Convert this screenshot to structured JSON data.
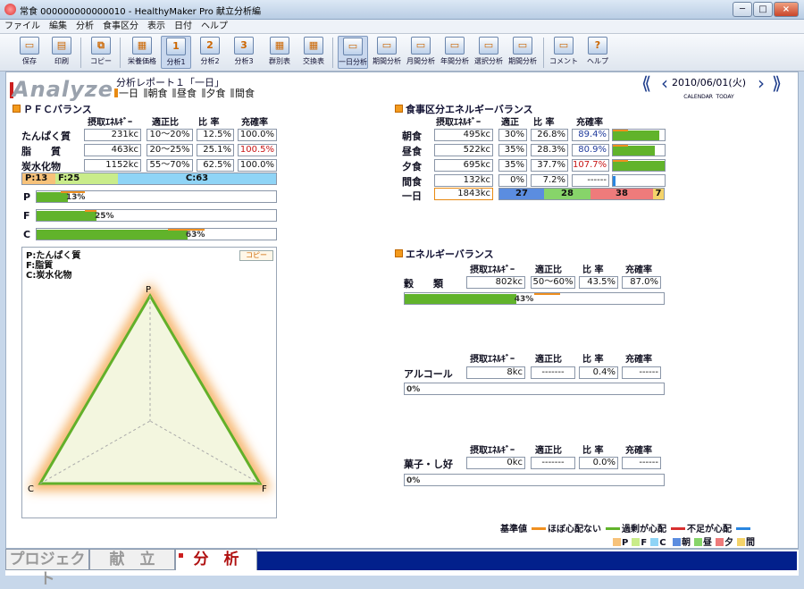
{
  "window": {
    "title": "常食 000000000000010 - HealthyMaker Pro 献立分析編",
    "min": "─",
    "max": "□",
    "close": "×"
  },
  "menu": [
    "ファイル",
    "編集",
    "分析",
    "食事区分",
    "表示",
    "日付",
    "ヘルプ"
  ],
  "toolbar": [
    {
      "label": "保存",
      "glyph": "▭"
    },
    {
      "label": "印刷",
      "glyph": "▤"
    },
    {
      "label": "コピー",
      "glyph": "⧉"
    },
    {
      "label": "栄養価格",
      "glyph": "▦"
    },
    {
      "label": "分析1",
      "glyph": "1"
    },
    {
      "label": "分析2",
      "glyph": "2"
    },
    {
      "label": "分析3",
      "glyph": "3"
    },
    {
      "label": "群別表",
      "glyph": "▦"
    },
    {
      "label": "交換表",
      "glyph": "▦"
    },
    {
      "label": "一日分析",
      "glyph": "▭"
    },
    {
      "label": "期間分析",
      "glyph": "▭"
    },
    {
      "label": "月間分析",
      "glyph": "▭"
    },
    {
      "label": "年間分析",
      "glyph": "▭"
    },
    {
      "label": "選択分析",
      "glyph": "▭"
    },
    {
      "label": "期間分析",
      "glyph": "▭"
    },
    {
      "label": "コメント",
      "glyph": "▭"
    },
    {
      "label": "ヘルプ",
      "glyph": "?"
    }
  ],
  "logo": "Analyze",
  "report": {
    "title": "分析レポート１「一日」",
    "tabs": [
      "一日",
      "朝食",
      "昼食",
      "夕食",
      "間食"
    ]
  },
  "date": {
    "value": "2010/06/01(火)",
    "calendar": "CALENDAR",
    "today": "TODAY"
  },
  "pfc": {
    "title": "ＰＦＣバランス",
    "headers": [
      "摂取ｴﾈﾙｷﾞｰ",
      "適正比",
      "比 率",
      "充確率"
    ],
    "rows": [
      {
        "label": "たんぱく質",
        "intake": "231kc",
        "range": "10～20%",
        "ratio": "12.5%",
        "rate": "100.0%"
      },
      {
        "label": "脂　　質",
        "intake": "463kc",
        "range": "20～25%",
        "ratio": "25.1%",
        "rate": "100.5%"
      },
      {
        "label": "炭水化物",
        "intake": "1152kc",
        "range": "55～70%",
        "ratio": "62.5%",
        "rate": "100.0%"
      }
    ],
    "stack": [
      {
        "label": "P:13",
        "value": 13
      },
      {
        "label": "F:25",
        "value": 25
      },
      {
        "label": "C:63",
        "value": 63
      }
    ],
    "bars": [
      {
        "letter": "P",
        "value": 13,
        "label": "13%"
      },
      {
        "letter": "F",
        "value": 25,
        "label": "25%"
      },
      {
        "letter": "C",
        "value": 63,
        "label": "63%"
      }
    ],
    "legend": [
      "P:たんぱく質",
      "F:脂質",
      "C:炭水化物"
    ],
    "copy": "コピー",
    "radar": {
      "p": "P",
      "c": "C",
      "f": "F"
    }
  },
  "meal": {
    "title": "食事区分エネルギーバランス",
    "headers": [
      "摂取ｴﾈﾙｷﾞｰ",
      "適正",
      "比 率",
      "充確率"
    ],
    "rows": [
      {
        "label": "朝食",
        "intake": "495kc",
        "std": "30%",
        "ratio": "26.8%",
        "rate": "89.4%",
        "fill": 89.4
      },
      {
        "label": "昼食",
        "intake": "522kc",
        "std": "35%",
        "ratio": "28.3%",
        "rate": "80.9%",
        "fill": 80.9
      },
      {
        "label": "夕食",
        "intake": "695kc",
        "std": "35%",
        "ratio": "37.7%",
        "rate": "107.7%",
        "fill": 100
      },
      {
        "label": "間食",
        "intake": "132kc",
        "std": "0%",
        "ratio": "7.2%",
        "rate": "------",
        "fill": 5
      }
    ],
    "total": {
      "label": "一日",
      "intake": "1843kc",
      "split": [
        {
          "label": "27",
          "value": 27
        },
        {
          "label": "28",
          "value": 28
        },
        {
          "label": "38",
          "value": 38
        },
        {
          "label": "7",
          "value": 7
        }
      ]
    }
  },
  "energy": {
    "title": "エネルギーバランス",
    "headers": [
      "摂取ｴﾈﾙｷﾞｰ",
      "適正比",
      "比 率",
      "充確率"
    ],
    "blocks": [
      {
        "label": "穀　　類",
        "intake": "802kc",
        "range": "50～60%",
        "ratio": "43.5%",
        "rate": "87.0%",
        "bar": 43,
        "bar_label": "43%"
      },
      {
        "label": "アルコール",
        "intake": "8kc",
        "range": "-------",
        "ratio": "0.4%",
        "rate": "------",
        "bar": 0,
        "bar_label": "0%"
      },
      {
        "label": "菓子・し好",
        "intake": "0kc",
        "range": "-------",
        "ratio": "0.0%",
        "rate": "------",
        "bar": 0,
        "bar_label": "0%"
      }
    ]
  },
  "legend": {
    "base": "基準値",
    "ok": "ほぼ心配ない",
    "over": "過剰が心配",
    "under": "不足が心配",
    "pfc": [
      "P",
      "F",
      "C"
    ],
    "meals": [
      "朝",
      "昼",
      "夕",
      "間"
    ]
  },
  "tabs": [
    "プロジェクト",
    "献　立",
    "分　析"
  ],
  "colors": {
    "p": "#f7c27a",
    "f": "#c9ec8a",
    "c": "#8fd4f6",
    "green": "#61b32b",
    "orange": "#f09020",
    "red": "#d83030",
    "blue": "#2a86e0",
    "breakfast": "#5b8de0",
    "lunch": "#87d46a",
    "dinner": "#ee7b7b",
    "snack": "#f4d36a"
  }
}
